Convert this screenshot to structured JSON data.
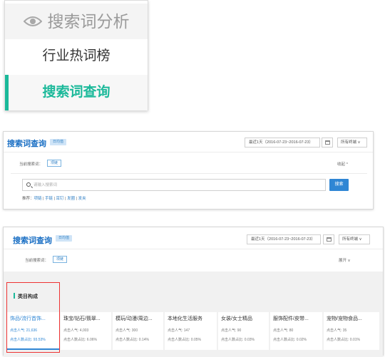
{
  "menu": {
    "item1": "搜索词分析",
    "item2": "行业热词榜",
    "item3": "搜索词查询"
  },
  "panel2": {
    "title": "搜索词查询",
    "tag": "日均值",
    "date": "最近1天（2016-07-23~2016-07-23）",
    "terminal": "所有终端 ∨",
    "current_label": "当前搜索词：",
    "keyword": "项链",
    "collapse": "收起 ^",
    "search_placeholder": "请输入搜索词",
    "search_button": "搜索",
    "recommend_label": "推荐：",
    "recommend": [
      "项链",
      "手链",
      "耳钉",
      "发圈",
      "发夹"
    ]
  },
  "panel3": {
    "title": "搜索词查询",
    "tag": "日均值",
    "date": "最近1天（2016-07-23~2016-07-23）",
    "terminal": "所有终端 ∨",
    "current_label": "当前搜索词：",
    "keyword": "项链",
    "expand": "展开 ∨",
    "section_title": "类目构成",
    "categories": [
      {
        "name": "饰品/流行首饰...",
        "pop": "点击人气: 21,636",
        "ratio": "点击人数占比: 93.53%"
      },
      {
        "name": "珠宝/钻石/翡翠...",
        "pop": "点击人气: 4,003",
        "ratio": "点击人数占比: 6.06%"
      },
      {
        "name": "模玩/动漫/周边...",
        "pop": "点击人气: 300",
        "ratio": "点击人数占比: 0.14%"
      },
      {
        "name": "本地化生活服务",
        "pop": "点击人气: 147",
        "ratio": "点击人数占比: 0.05%"
      },
      {
        "name": "女装/女士精品",
        "pop": "点击人气: 90",
        "ratio": "点击人数占比: 0.03%"
      },
      {
        "name": "服饰配件/皮带...",
        "pop": "点击人气: 80",
        "ratio": "点击人数占比: 0.02%"
      },
      {
        "name": "宠物/宠物食品...",
        "pop": "点击人气: 35",
        "ratio": "点击人数占比: 0.01%"
      }
    ]
  }
}
